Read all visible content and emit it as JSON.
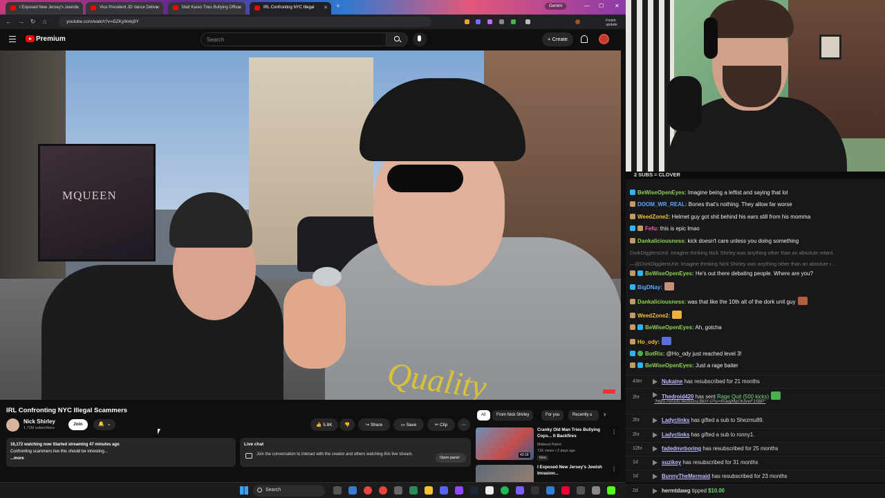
{
  "browser": {
    "tabs": [
      {
        "label": "I Exposed New Jersey's Jewish"
      },
      {
        "label": "Vice President JD Vance Delive"
      },
      {
        "label": "Matt Karen Tries Bullying Office"
      },
      {
        "label": "IRL Confronting NYC Illegal"
      }
    ],
    "gemini_label": "Gemini",
    "url": "youtube.com/watch?v=i5ZKy9mkj9Y",
    "finish_update": "Finish update"
  },
  "youtube": {
    "brand": "Premium",
    "search_placeholder": "Search",
    "create_label": "Create",
    "video_title": "IRL Confronting NYC Illegal Scammers",
    "billboard_text": "MQUEEN",
    "shirt_text": "Quality",
    "channel": {
      "name": "Nick Shirley",
      "subs": "1.71M subscribers",
      "join": "Join"
    },
    "actions": {
      "likes": "5.8K",
      "share": "Share",
      "save": "Save",
      "clip": "Clip"
    },
    "description": {
      "line1": "16,172 watching now  Started streaming 47 minutes ago",
      "line2": "Confronting scammers live this should be intresting...",
      "more": "...more"
    },
    "live_chat": {
      "title": "Live chat",
      "text": "Join the conversation to interact with the creator and others watching this live stream.",
      "open_panel": "Open panel"
    },
    "chips": [
      "All",
      "From Nick Shirley",
      "For you",
      "Recently u"
    ],
    "recommendations": [
      {
        "title": "Cranky Old Man Tries Bullying Cops... It Backfires",
        "channel": "Midwest Patrol",
        "meta": "71K views • 2 days ago",
        "badge": "New",
        "duration": "43:18"
      },
      {
        "title": "I Exposed New Jersey's Jewish Invasion...",
        "channel": "",
        "meta": "",
        "badge": "",
        "duration": ""
      }
    ]
  },
  "taskbar": {
    "search": "Search"
  },
  "chat": {
    "banner": "2 SUBS = CLOVER",
    "messages": [
      {
        "user": "BeWiseOpenEyes:",
        "text": " Imagine being a leftist and saying that lol",
        "color": "#8fd14f"
      },
      {
        "user": "DOOM_WR_REAL:",
        "text": " Bones that's nothing. They allow far worse",
        "color": "#5aa9ff"
      },
      {
        "user": "WeedZone2:",
        "text": " Helmet guy got shit behind his ears still from his momma",
        "color": "#f2c230"
      },
      {
        "user": "Fefu:",
        "text": " this is epic lmao",
        "color": "#ff5aa8"
      },
      {
        "user": "Dankaliciousness:",
        "text": " kick doesn't care unless you doing something",
        "color": "#8fd14f"
      },
      {
        "user": "",
        "text": "DorkDigglersUnit: Imagine thinking Nick Shirley was anything other than an absolute retard.",
        "color": "#777"
      },
      {
        "user": "",
        "text": "—@DorkDigglersUnit: Imagine thinking Nick Shirley was anything other than an absolute r...",
        "color": "#777"
      },
      {
        "user": "BeWiseOpenEyes:",
        "text": " He's out there debating people. Where are you?",
        "color": "#8fd14f"
      },
      {
        "user": "BigDNay:",
        "text": "",
        "color": "#5aa9ff"
      },
      {
        "user": "Dankaliciousness:",
        "text": " was that like the 10th alt of the dork unit guy",
        "color": "#8fd14f"
      },
      {
        "user": "WeedZone2:",
        "text": "",
        "color": "#f2c230"
      },
      {
        "user": "BeWiseOpenEyes:",
        "text": " Ah, gotcha",
        "color": "#8fd14f"
      },
      {
        "user": "Ho_ody:",
        "text": "",
        "color": "#f2c230"
      },
      {
        "user": "BotRix:",
        "text": " @Ho_ody just reached level 3!",
        "color": "#8fd14f"
      },
      {
        "user": "BeWiseOpenEyes:",
        "text": " Just a rage baiter",
        "color": "#8fd14f"
      }
    ],
    "events": [
      {
        "time": "43m",
        "user": "Nukaine",
        "text": " has resubscribed for 21 months",
        "extra": ""
      },
      {
        "time": "2hr",
        "user": "Thedroid420",
        "text": " has sent ",
        "extra": "Rage Quit (500 kicks)",
        "link": "\"https://youtu.be/psxsLBkIY-0?si=RuejjMgOk3veF15BP\""
      },
      {
        "time": "2hr",
        "user": "Ladyclinks",
        "text": " has gifted a sub to Shezmu89.",
        "extra": ""
      },
      {
        "time": "2hr",
        "user": "Ladyclinks",
        "text": " has gifted a sub to ronny1.",
        "extra": ""
      },
      {
        "time": "12hr",
        "user": "fadednvrboring",
        "text": " has resubscribed for 25 months",
        "extra": ""
      },
      {
        "time": "1d",
        "user": "suzikey",
        "text": " has resubscribed for 31 months",
        "extra": ""
      },
      {
        "time": "1d",
        "user": "BunnyTheMermaid",
        "text": " has resubscribed for 23 months",
        "extra": ""
      },
      {
        "time": "2d",
        "user": "hermtdawg",
        "text": " tipped ",
        "extra": "$10.00"
      }
    ]
  }
}
